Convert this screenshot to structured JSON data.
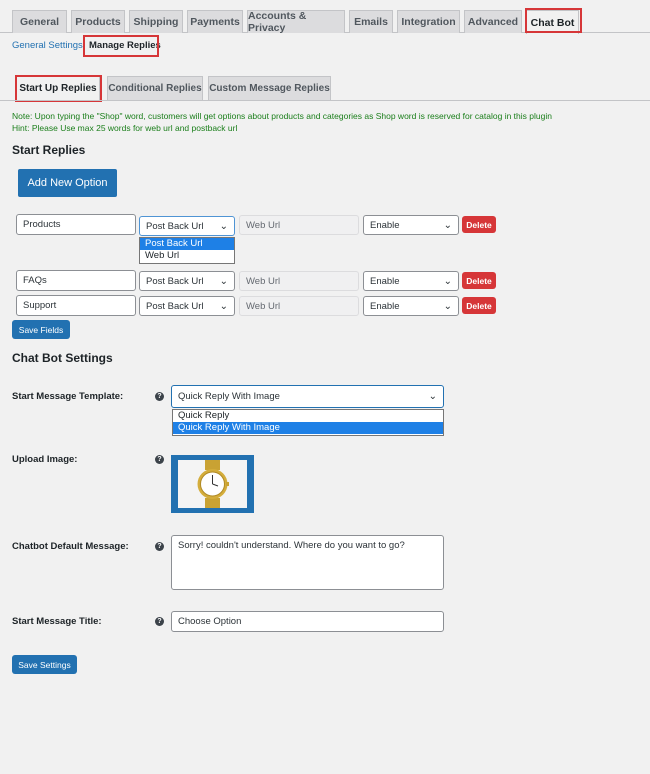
{
  "tabs": [
    "General",
    "Products",
    "Shipping",
    "Payments",
    "Accounts & Privacy",
    "Emails",
    "Integration",
    "Advanced",
    "Chat Bot"
  ],
  "subnav": {
    "general": "General Settings",
    "manage": "Manage Replies"
  },
  "reply_tabs": [
    "Start Up Replies",
    "Conditional Replies",
    "Custom Message Replies"
  ],
  "notes": {
    "line1": "Note: Upon typing the \"Shop\" word, customers will get options about products and categories as Shop word is reserved for catalog in this plugin",
    "line2": "Hint: Please Use max 25 words for web url and postback url"
  },
  "start_replies": {
    "heading": "Start Replies",
    "add_button": "Add New Option",
    "rows": [
      {
        "name": "Products",
        "type": "Post Back Url",
        "url_placeholder": "Web Url",
        "status": "Enable",
        "delete": "Delete"
      },
      {
        "name": "FAQs",
        "type": "Post Back Url",
        "url_placeholder": "Web Url",
        "status": "Enable",
        "delete": "Delete"
      },
      {
        "name": "Support",
        "type": "Post Back Url",
        "url_placeholder": "Web Url",
        "status": "Enable",
        "delete": "Delete"
      }
    ],
    "type_options": [
      "Post Back Url",
      "Web Url"
    ],
    "save_button": "Save Fields"
  },
  "chatbot_settings": {
    "heading": "Chat Bot Settings",
    "template_label": "Start Message Template:",
    "template_value": "Quick Reply With Image",
    "template_options": [
      "Quick Reply",
      "Quick Reply With Image"
    ],
    "upload_label": "Upload Image:",
    "default_msg_label": "Chatbot Default Message:",
    "default_msg_value": "Sorry! couldn't understand. Where do you want to go?",
    "title_label": "Start Message Title:",
    "title_value": "Choose Option",
    "save_button": "Save Settings"
  },
  "icons": {
    "help": "question-circle-icon",
    "chevron": "chevron-down-icon",
    "image": "watch-image"
  },
  "colors": {
    "primary": "#2271b1",
    "danger": "#d63638",
    "highlight": "#d63638",
    "note": "#1a7e1a",
    "selected": "#1e80e6"
  }
}
